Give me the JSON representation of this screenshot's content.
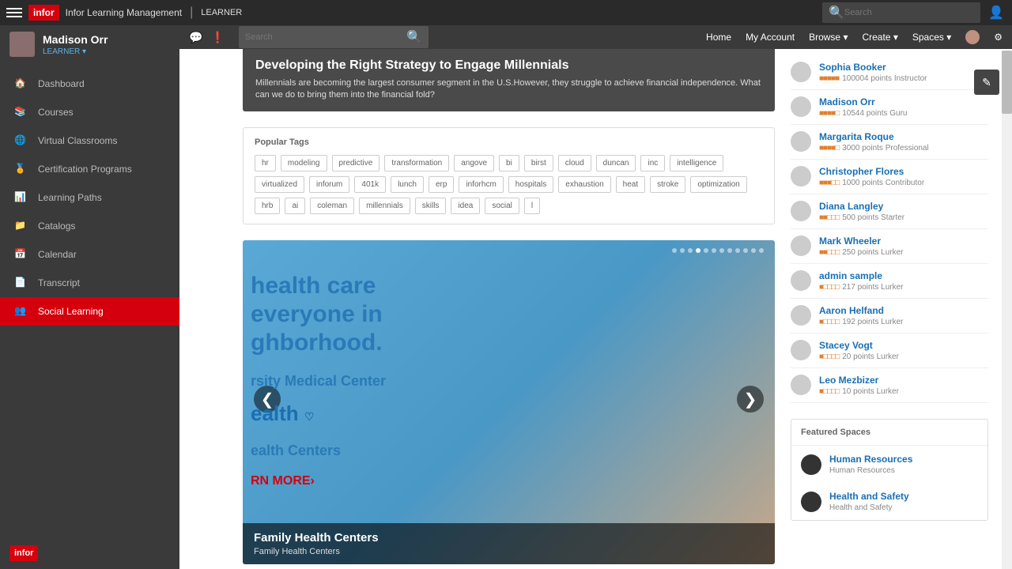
{
  "topbar": {
    "app": "Infor Learning Management",
    "context": "LEARNER",
    "search_ph": "Search",
    "logo": "infor"
  },
  "sidebar": {
    "user": {
      "name": "Madison Orr",
      "role": "LEARNER"
    },
    "items": [
      {
        "label": "Dashboard"
      },
      {
        "label": "Courses"
      },
      {
        "label": "Virtual Classrooms"
      },
      {
        "label": "Certification Programs"
      },
      {
        "label": "Learning Paths"
      },
      {
        "label": "Catalogs"
      },
      {
        "label": "Calendar"
      },
      {
        "label": "Transcript"
      },
      {
        "label": "Social Learning"
      }
    ],
    "footer_logo": "infor"
  },
  "mainnav": {
    "search_ph": "Search",
    "links": [
      "Home",
      "My Account",
      "Browse ▾",
      "Create ▾",
      "Spaces ▾"
    ]
  },
  "hero": {
    "title": "Developing the Right Strategy to Engage Millennials",
    "body": "Millennials are becoming the largest consumer segment in the U.S.However, they struggle to achieve financial independence. What can we do to bring them into the financial fold?"
  },
  "tags": {
    "heading": "Popular Tags",
    "items": [
      "hr",
      "modeling",
      "predictive",
      "transformation",
      "angove",
      "bi",
      "birst",
      "cloud",
      "duncan",
      "inc",
      "intelligence",
      "virtualized",
      "inforum",
      "401k",
      "lunch",
      "erp",
      "inforhcm",
      "hospitals",
      "exhaustion",
      "heat",
      "stroke",
      "optimization",
      "hrb",
      "ai",
      "coleman",
      "millennials",
      "skills",
      "idea",
      "social",
      "l"
    ]
  },
  "carousel": {
    "promo": "health care\neveryone in\nghborhood.",
    "sub1": "rsity Medical Center",
    "sub2": "ealth Centers",
    "learn": "RN MORE›",
    "caption_title": "Family Health Centers",
    "caption_sub": "Family Health Centers",
    "dot_count": 12,
    "active_dot": 3
  },
  "leaderboard": [
    {
      "name": "Sophia Booker",
      "points": "100004 points",
      "role": "Instructor",
      "bars": 5
    },
    {
      "name": "Madison Orr",
      "points": "10544 points",
      "role": "Guru",
      "bars": 4
    },
    {
      "name": "Margarita Roque",
      "points": "3000 points",
      "role": "Professional",
      "bars": 4
    },
    {
      "name": "Christopher Flores",
      "points": "1000 points",
      "role": "Contributor",
      "bars": 3
    },
    {
      "name": "Diana Langley",
      "points": "500 points",
      "role": "Starter",
      "bars": 2
    },
    {
      "name": "Mark Wheeler",
      "points": "250 points",
      "role": "Lurker",
      "bars": 2
    },
    {
      "name": "admin sample",
      "points": "217 points",
      "role": "Lurker",
      "bars": 1
    },
    {
      "name": "Aaron Helfand",
      "points": "192 points",
      "role": "Lurker",
      "bars": 1
    },
    {
      "name": "Stacey Vogt",
      "points": "20 points",
      "role": "Lurker",
      "bars": 1
    },
    {
      "name": "Leo Mezbizer",
      "points": "10 points",
      "role": "Lurker",
      "bars": 1
    }
  ],
  "featured": {
    "heading": "Featured Spaces",
    "spaces": [
      {
        "name": "Human Resources",
        "desc": "Human Resources"
      },
      {
        "name": "Health and Safety",
        "desc": "Health and Safety"
      }
    ]
  }
}
